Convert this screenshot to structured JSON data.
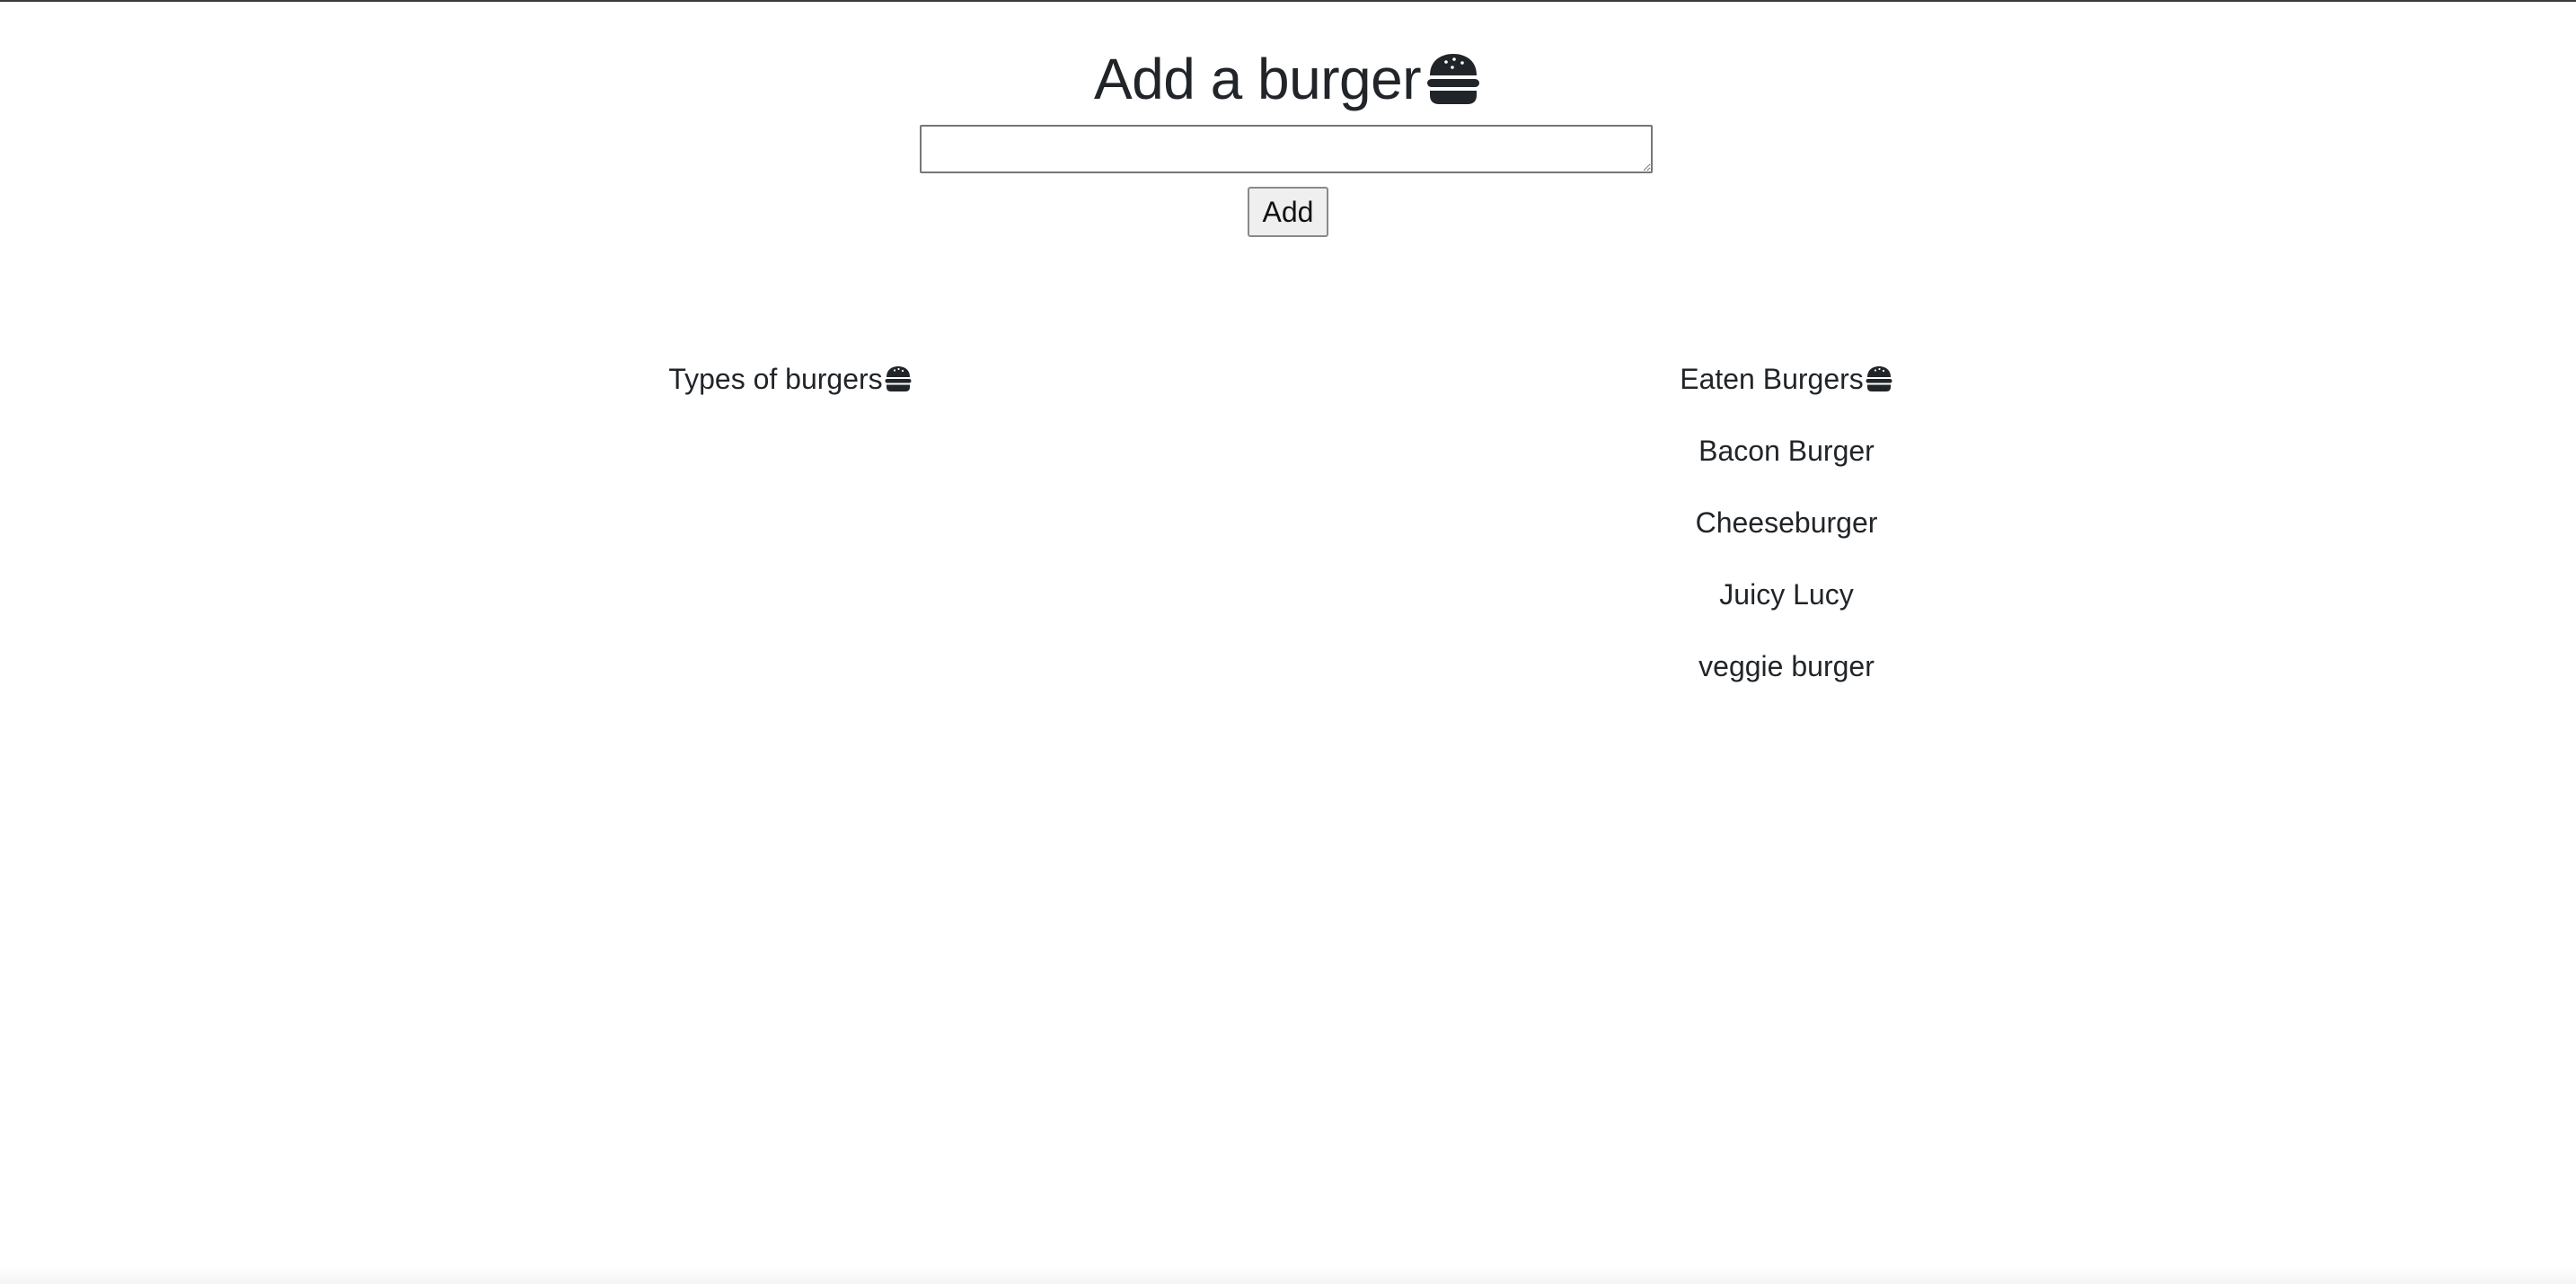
{
  "header": {
    "title": "Add a burger",
    "icon": "burger-icon"
  },
  "form": {
    "textarea_value": "",
    "add_label": "Add"
  },
  "types_column": {
    "heading": "Types of burgers",
    "icon": "burger-icon",
    "items": []
  },
  "eaten_column": {
    "heading": "Eaten Burgers",
    "icon": "burger-icon",
    "items": [
      "Bacon Burger",
      "Cheeseburger",
      "Juicy Lucy",
      "veggie burger"
    ]
  },
  "colors": {
    "text": "#212529",
    "background": "#ffffff",
    "button_bg": "#efefef"
  }
}
